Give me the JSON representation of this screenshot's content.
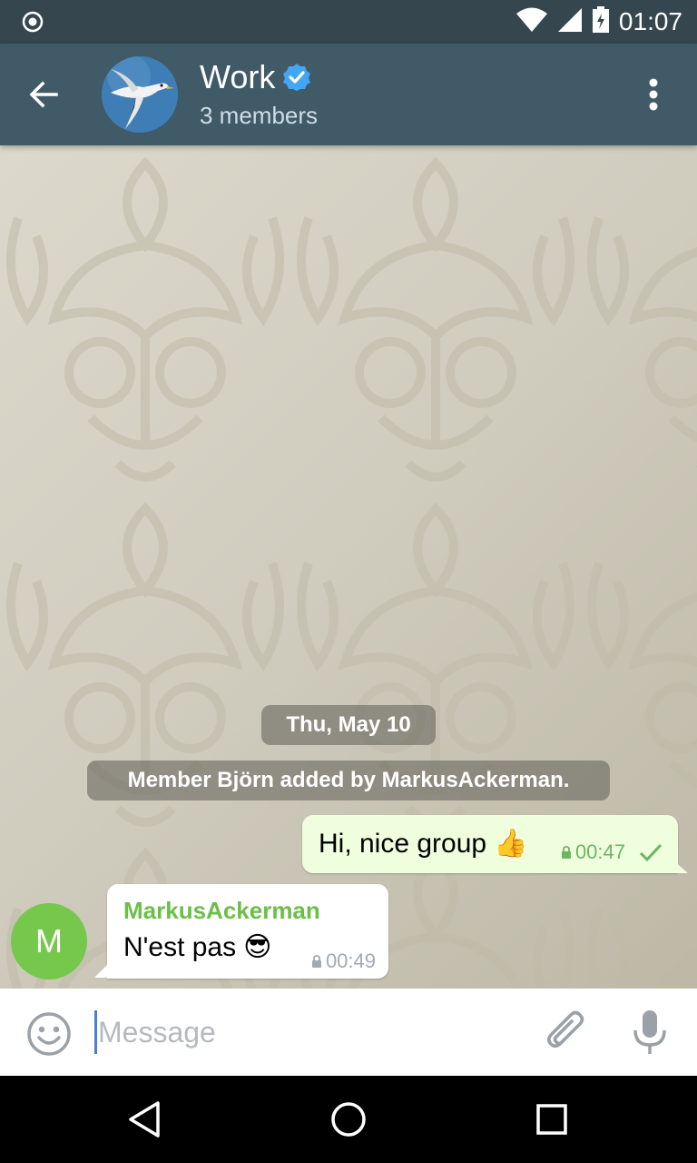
{
  "status_bar": {
    "time": "01:07",
    "icons": [
      "record-icon",
      "wifi-icon",
      "signal-icon",
      "battery-charging-icon"
    ]
  },
  "header": {
    "title": "Work",
    "verified": true,
    "subtitle": "3 members",
    "icons": [
      "back-arrow-icon",
      "group-avatar-seagull",
      "verified-badge-icon",
      "more-vert-icon"
    ]
  },
  "chat": {
    "date_label": "Thu, May 10",
    "service_message": "Member Björn added by MarkusAckerman.",
    "messages": [
      {
        "direction": "outgoing",
        "text": "Hi, nice group",
        "emoji": "👍",
        "time": "00:47",
        "status": "sent-check"
      },
      {
        "direction": "incoming",
        "sender": "MarkusAckerman",
        "avatar_letter": "M",
        "text": "N'est pas",
        "emoji": "😎",
        "time": "00:49"
      }
    ]
  },
  "composer": {
    "placeholder": "Message",
    "value": "",
    "icons": [
      "emoji-icon",
      "attach-icon",
      "mic-icon"
    ]
  },
  "nav_bar": {
    "icons": [
      "nav-back-icon",
      "nav-home-icon",
      "nav-recents-icon"
    ]
  },
  "colors": {
    "status_bar": "#35464f",
    "app_bar": "#415a67",
    "outgoing_bubble": "#effedd",
    "incoming_sender": "#6ac046",
    "member_avatar": "#76c84d",
    "check_green": "#6db564"
  }
}
